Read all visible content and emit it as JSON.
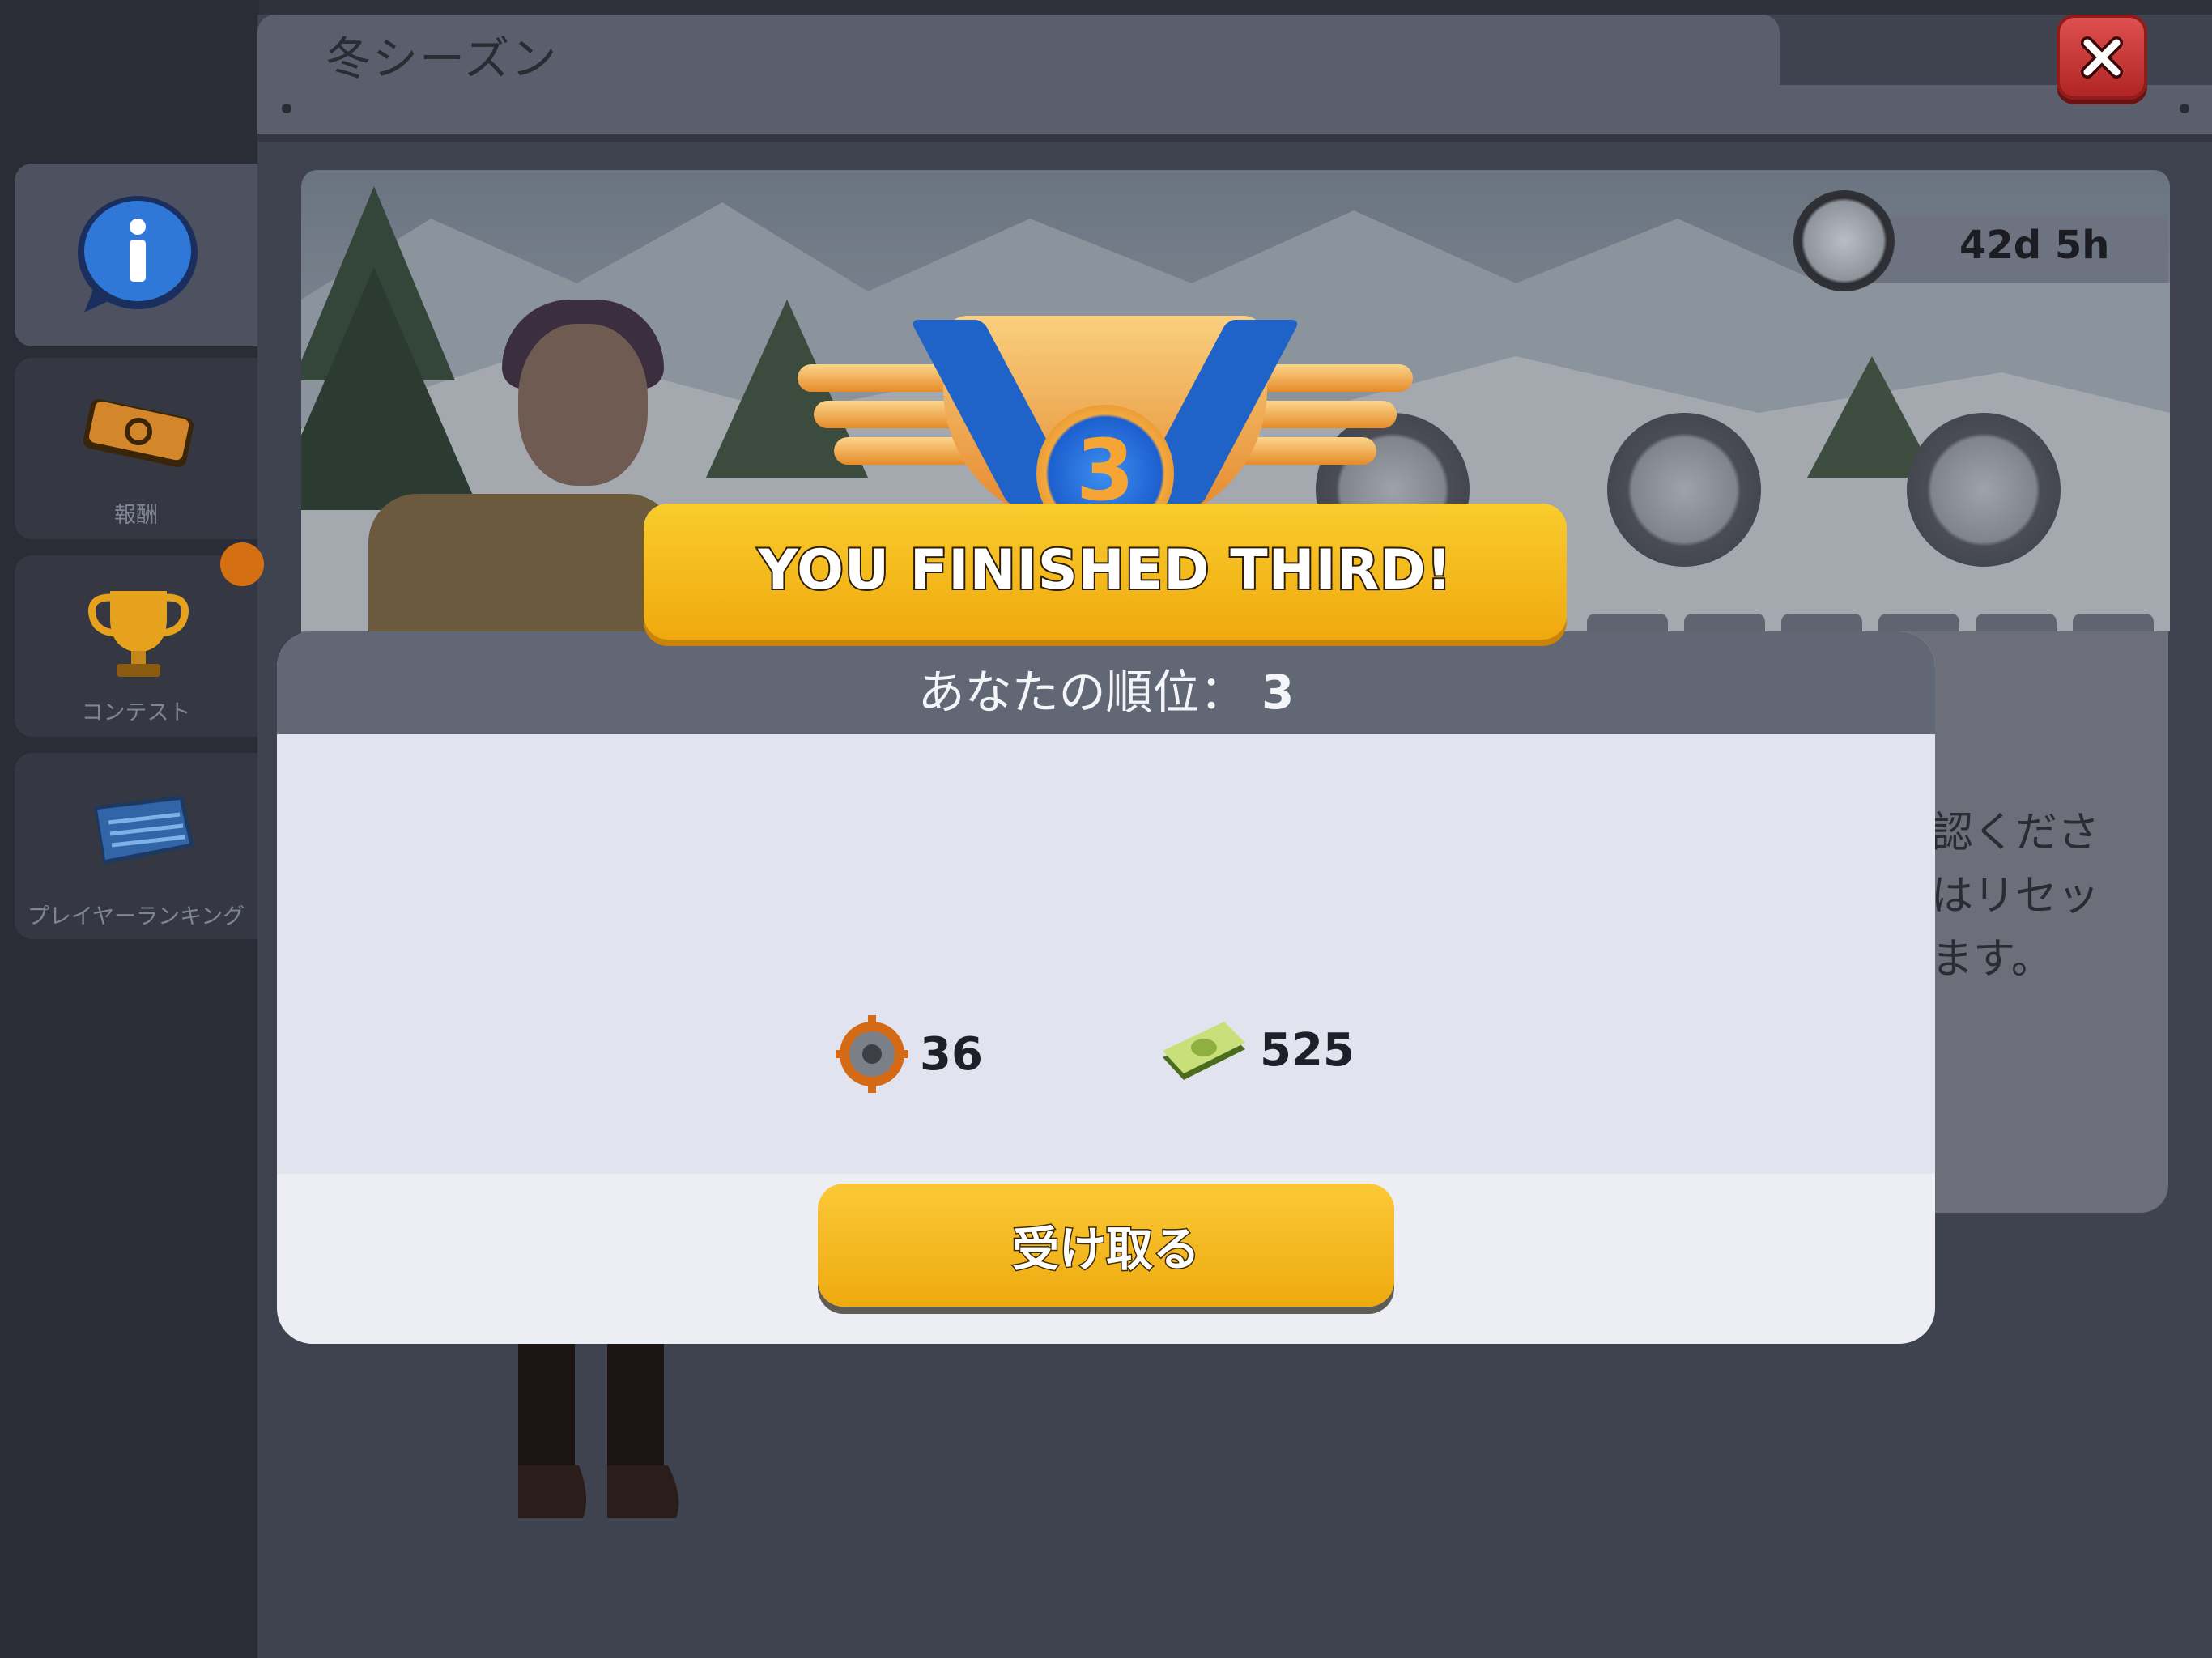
{
  "window": {
    "title": "冬シーズン",
    "close_icon": "close-icon"
  },
  "sidebar": {
    "items": [
      {
        "label": "",
        "icon": "info-icon",
        "active": true
      },
      {
        "label": "報酬",
        "icon": "ticket-icon",
        "active": false
      },
      {
        "label": "コンテスト",
        "icon": "trophy-icon",
        "active": false
      },
      {
        "label": "プレイヤーランキング",
        "icon": "ranking-board-icon",
        "active": false
      }
    ]
  },
  "season": {
    "time_remaining": "42d 5h",
    "timer_icon": "stopwatch-icon"
  },
  "background_text": {
    "line1": "認くださ",
    "line2": "はリセッ",
    "line3": "ます。"
  },
  "result": {
    "banner": "YOU FINISHED THIRD!",
    "medal_number": "3",
    "rank_label": "あなたの順位：",
    "rank_value": "3"
  },
  "rewards": [
    {
      "icon": "gear-token-icon",
      "amount": "36"
    },
    {
      "icon": "cash-bundle-icon",
      "amount": "525"
    }
  ],
  "claim_button": {
    "label": "受け取る"
  },
  "colors": {
    "accent_yellow": "#f4b417",
    "close_red": "#c73232",
    "dialog_header": "#626775"
  }
}
